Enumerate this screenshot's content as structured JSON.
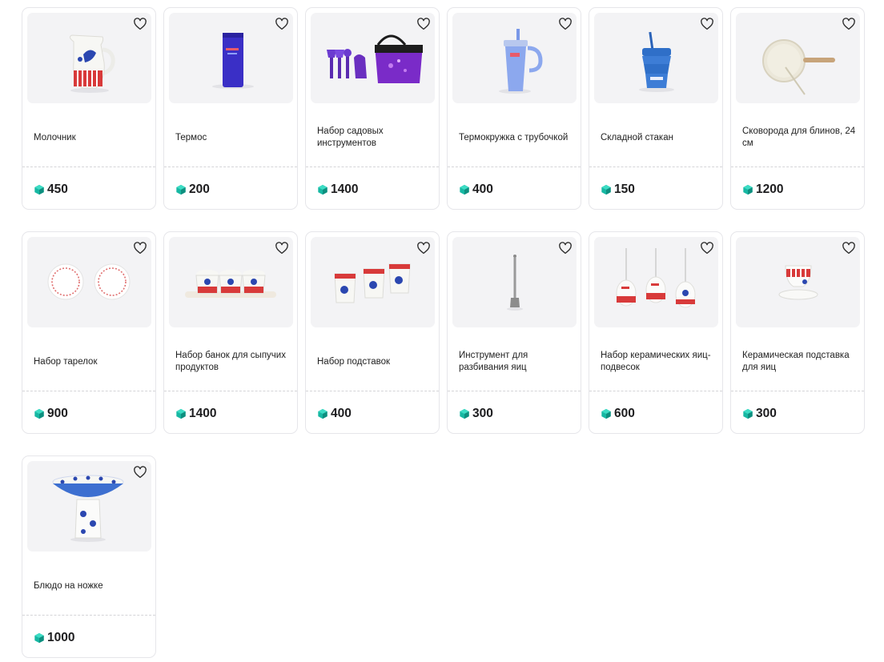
{
  "accent_color": "#17b8a3",
  "currency_icon": "gem-icon",
  "favorite_icon": "heart-outline-icon",
  "products": [
    {
      "name": "Молочник",
      "price": "450",
      "image": "milk-jug-image"
    },
    {
      "name": "Термос",
      "price": "200",
      "image": "thermos-image"
    },
    {
      "name": "Набор садовых инструментов",
      "price": "1400",
      "image": "garden-tools-set-image"
    },
    {
      "name": "Термокружка с трубочкой",
      "price": "400",
      "image": "thermo-mug-straw-image"
    },
    {
      "name": "Складной стакан",
      "price": "150",
      "image": "folding-cup-image"
    },
    {
      "name": "Сковорода для блинов, 24 см",
      "price": "1200",
      "image": "crepe-pan-image"
    },
    {
      "name": "Набор тарелок",
      "price": "900",
      "image": "plates-set-image"
    },
    {
      "name": "Набор банок для сыпучих продуктов",
      "price": "1400",
      "image": "jars-set-image"
    },
    {
      "name": "Набор подставок",
      "price": "400",
      "image": "stands-set-image"
    },
    {
      "name": "Инструмент для разбивания яиц",
      "price": "300",
      "image": "egg-cracker-image"
    },
    {
      "name": "Набор керамических яиц-подвесок",
      "price": "600",
      "image": "ceramic-egg-ornaments-image"
    },
    {
      "name": "Керамическая подставка для яиц",
      "price": "300",
      "image": "egg-cup-image"
    },
    {
      "name": "Блюдо на ножке",
      "price": "1000",
      "image": "footed-dish-image"
    }
  ]
}
